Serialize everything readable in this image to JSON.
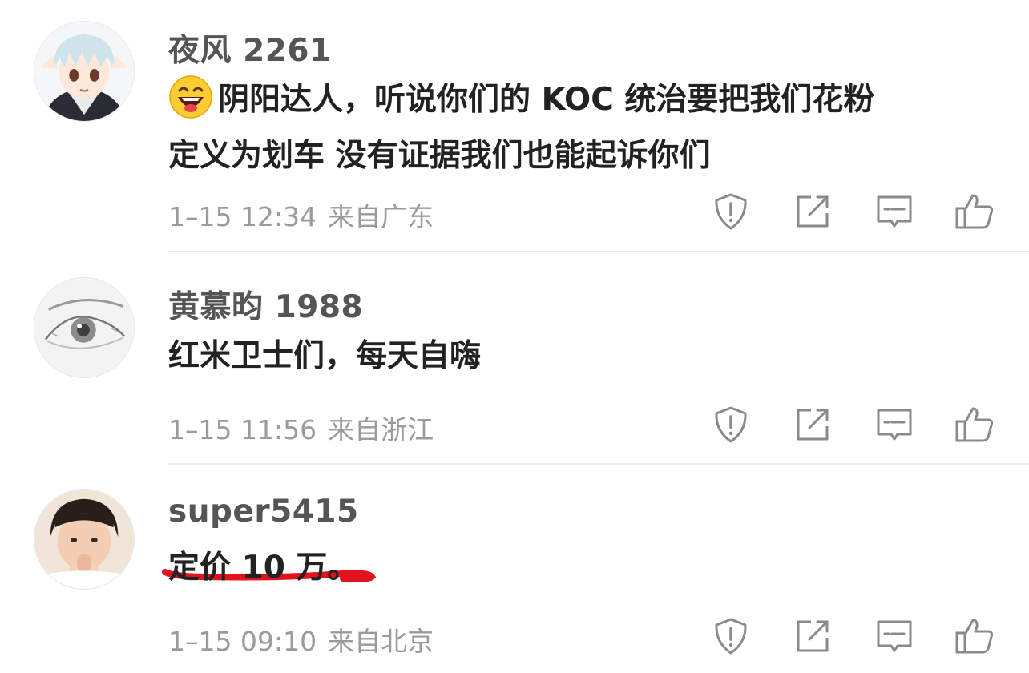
{
  "comments": [
    {
      "username": "夜风 2261",
      "emoji": "laughing-emoji",
      "text_line1": "阴阳达人，听说你们的 KOC 统治要把我们花粉",
      "text_line2": "定义为划车 没有证据我们也能起诉你们",
      "time": "1–15 12:34",
      "location": "来自广东"
    },
    {
      "username": "黄慕昀 1988",
      "text_line1": "红米卫士们，每天自嗨",
      "time": "1–15 11:56",
      "location": "来自浙江"
    },
    {
      "username": "super5415",
      "text_line1": "定价 10 万。",
      "time": "1–15 09:10",
      "location": "来自北京"
    }
  ],
  "icons": {
    "report": "exclamation-shield-icon",
    "share": "share-external-icon",
    "reply": "comment-icon",
    "like": "thumbs-up-icon"
  },
  "colors": {
    "annotation_red": "#e0131f",
    "meta_gray": "#9b9b9b",
    "icon_gray": "#8a8a8a"
  }
}
